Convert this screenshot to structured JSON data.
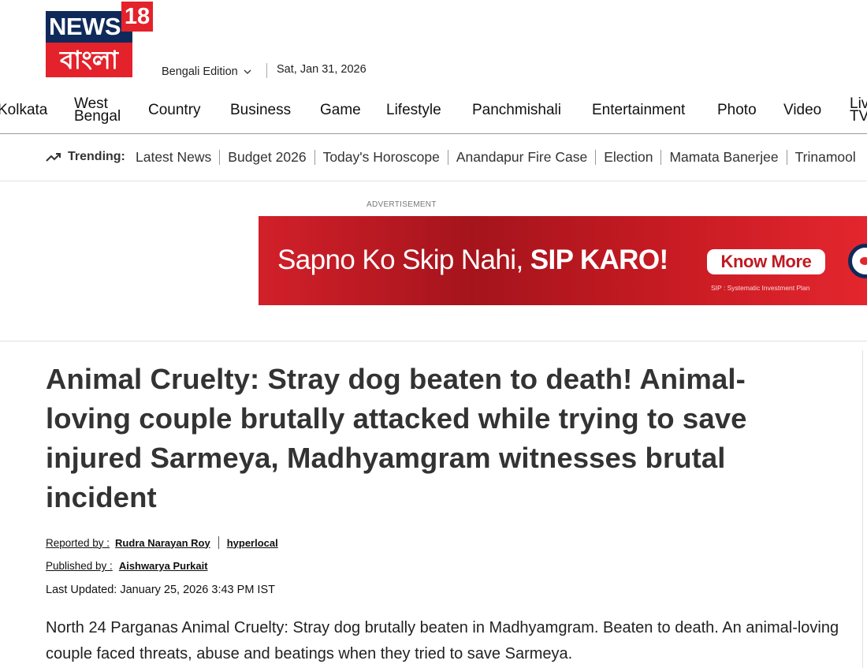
{
  "brand": {
    "logo_top": "NEWS",
    "logo_num": "18",
    "logo_bengali": "বাংলা"
  },
  "header": {
    "edition": "Bengali Edition",
    "date": "Sat, Jan 31, 2026"
  },
  "nav": {
    "items": [
      {
        "label": "Kolkata"
      },
      {
        "label": "West Bengal"
      },
      {
        "label": "Country"
      },
      {
        "label": "Business"
      },
      {
        "label": "Game"
      },
      {
        "label": "Lifestyle"
      },
      {
        "label": "Panchmishali"
      },
      {
        "label": "Entertainment"
      },
      {
        "label": "Photo"
      },
      {
        "label": "Video"
      },
      {
        "label": "Live TV"
      }
    ]
  },
  "trending": {
    "label": "Trending:",
    "items": [
      "Latest News",
      "Budget 2026",
      "Today's Horoscope",
      "Anandapur Fire Case",
      "Election",
      "Mamata Banerjee",
      "Trinamool"
    ]
  },
  "ad": {
    "label": "ADVERTISEMENT",
    "text_regular": "Sapno Ko Skip Nahi, ",
    "text_bold": "SIP KARO!",
    "button": "Know More",
    "footnote": "SIP : Systematic Investment Plan",
    "colors": {
      "background": "#c51a22",
      "button_text": "#c01a22"
    }
  },
  "article": {
    "headline": "Animal Cruelty: Stray dog beaten to death! Animal-loving couple brutally attacked while trying to save injured Sarmeya, Madhyamgram witnesses brutal incident",
    "reported_label": "Reported by :",
    "reporter": "Rudra Narayan Roy",
    "category": "hyperlocal",
    "published_label": "Published by :",
    "publisher": "Aishwarya Purkait",
    "updated": "Last Updated: January 25, 2026 3:43 PM IST",
    "summary": "North 24 Parganas Animal Cruelty: Stray dog brutally beaten in Madhyamgram. Beaten to death. An animal-loving couple faced threats, abuse and beatings when they tried to save Sarmeya."
  },
  "colors": {
    "brand_red": "#e3222b",
    "brand_navy": "#0f2a5a",
    "headline": "#333333"
  }
}
